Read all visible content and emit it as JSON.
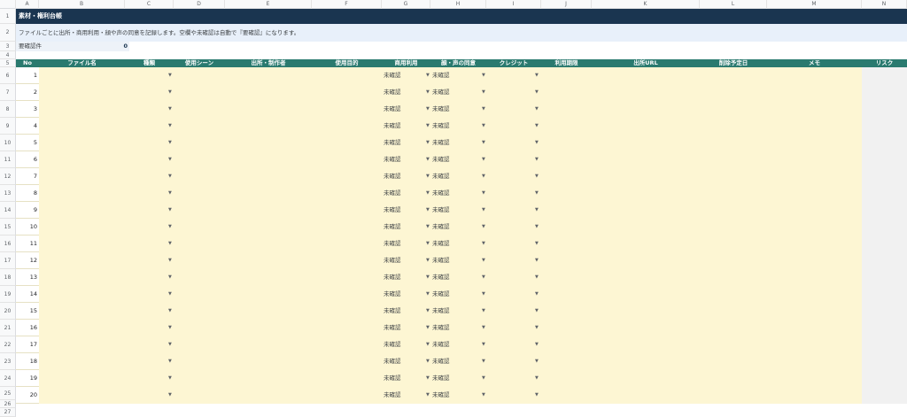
{
  "column_letters": [
    "A",
    "B",
    "C",
    "D",
    "E",
    "F",
    "G",
    "H",
    "I",
    "J",
    "K",
    "L",
    "M",
    "N"
  ],
  "row_numbers": [
    "1",
    "2",
    "3",
    "4",
    "5",
    "6",
    "7",
    "8",
    "9",
    "10",
    "11",
    "12",
    "13",
    "14",
    "15",
    "16",
    "17",
    "18",
    "19",
    "20",
    "21",
    "22",
    "23",
    "24",
    "25",
    "26",
    "27"
  ],
  "sheet": {
    "title": "素材・権利台帳",
    "description": "ファイルごとに出所・商用利用・顔や声の同意を記録します。空欄や未確認は自動で『要確認』になります。",
    "count_label": "要確認件",
    "count_value": "0"
  },
  "headers": [
    "No",
    "ファイル名",
    "種類",
    "使用シーン",
    "出所・制作者",
    "使用目的",
    "商用利用",
    "顔・声の同意",
    "クレジット",
    "利用期限",
    "出所URL",
    "削除予定日",
    "メモ",
    "リスク"
  ],
  "rows": [
    {
      "no": "1",
      "commercial": "未確認",
      "consent": "未確認"
    },
    {
      "no": "2",
      "commercial": "未確認",
      "consent": "未確認"
    },
    {
      "no": "3",
      "commercial": "未確認",
      "consent": "未確認"
    },
    {
      "no": "4",
      "commercial": "未確認",
      "consent": "未確認"
    },
    {
      "no": "5",
      "commercial": "未確認",
      "consent": "未確認"
    },
    {
      "no": "6",
      "commercial": "未確認",
      "consent": "未確認"
    },
    {
      "no": "7",
      "commercial": "未確認",
      "consent": "未確認"
    },
    {
      "no": "8",
      "commercial": "未確認",
      "consent": "未確認"
    },
    {
      "no": "9",
      "commercial": "未確認",
      "consent": "未確認"
    },
    {
      "no": "10",
      "commercial": "未確認",
      "consent": "未確認"
    },
    {
      "no": "11",
      "commercial": "未確認",
      "consent": "未確認"
    },
    {
      "no": "12",
      "commercial": "未確認",
      "consent": "未確認"
    },
    {
      "no": "13",
      "commercial": "未確認",
      "consent": "未確認"
    },
    {
      "no": "14",
      "commercial": "未確認",
      "consent": "未確認"
    },
    {
      "no": "15",
      "commercial": "未確認",
      "consent": "未確認"
    },
    {
      "no": "16",
      "commercial": "未確認",
      "consent": "未確認"
    },
    {
      "no": "17",
      "commercial": "未確認",
      "consent": "未確認"
    },
    {
      "no": "18",
      "commercial": "未確認",
      "consent": "未確認"
    },
    {
      "no": "19",
      "commercial": "未確認",
      "consent": "未確認"
    },
    {
      "no": "20",
      "commercial": "未確認",
      "consent": "未確認"
    }
  ],
  "dropdown_icon": "triangle-down",
  "colors": {
    "title_bg": "#1a3550",
    "description_bg": "#e8f0fa",
    "header_bg": "#2a7a6f",
    "cell_bg": "#fdf6d3",
    "risk_bg": "#f1f1f1"
  }
}
